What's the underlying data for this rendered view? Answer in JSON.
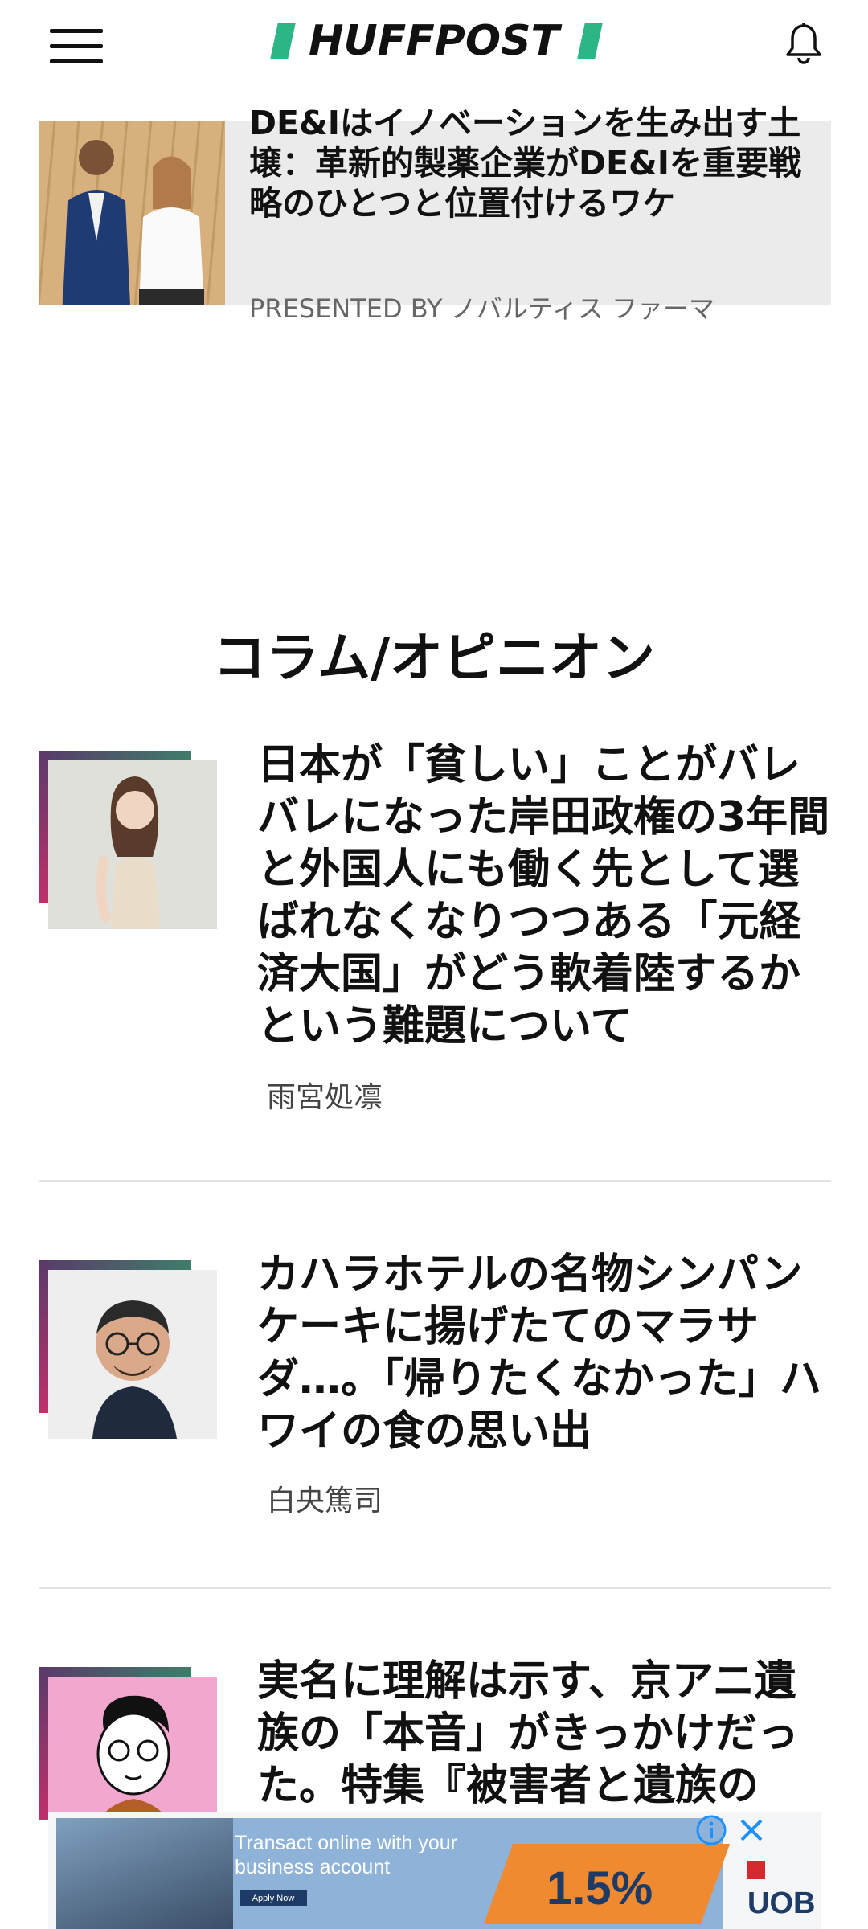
{
  "header": {
    "logo_text": "HUFFPOST",
    "menu_icon": "hamburger-menu-icon",
    "notifications_icon": "bell-icon",
    "brand_color": "#2cb585"
  },
  "promo": {
    "title": "DE&Iはイノベーションを生み出す土壌：革新的製薬企業がDE&Iを重要戦略のひとつと位置付けるワケ",
    "sponsor": "PRESENTED BY ノバルティス ファーマ"
  },
  "section": {
    "title": "コラム/オピニオン"
  },
  "articles": [
    {
      "title": "日本が「貧しい」ことがバレバレになった岸田政権の3年間と外国人にも働く先として選ばれなくなりつつある「元経済大国」がどう軟着陸するかという難題について",
      "author": "雨宮処凛"
    },
    {
      "title": "カハラホテルの名物シンパンケーキに揚げたてのマラサダ…。「帰りたくなかった」ハワイの食の思い出",
      "author": "白央篤司"
    },
    {
      "title": "実名に理解は示す、京アニ遺族の「本音」がきっかけだった。特集『被害者と遺族の",
      "author": ""
    }
  ],
  "ad": {
    "headline": "Transact online with your business account",
    "button": "Apply Now",
    "rate": "1.5%",
    "brand": "UOB",
    "info_icon": "info-icon",
    "close_icon": "close-icon"
  }
}
